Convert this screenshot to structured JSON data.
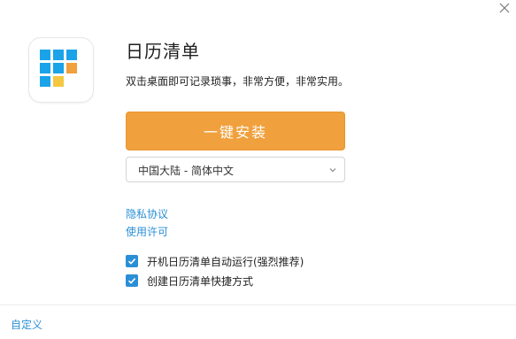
{
  "window": {
    "close_icon": "close-icon"
  },
  "app": {
    "icon": "calendar-grid-icon",
    "name": "日历清单",
    "description": "双击桌面即可记录琐事，非常方便，非常实用。"
  },
  "install": {
    "button_label": "一键安装",
    "accent_color": "#f0a03c"
  },
  "region_select": {
    "selected": "中国大陆 - 简体中文",
    "chevron_icon": "chevron-down-icon"
  },
  "links": {
    "privacy": "隐私协议",
    "license": "使用许可"
  },
  "options": [
    {
      "label": "开机日历清单自动运行(强烈推荐)",
      "checked": true
    },
    {
      "label": "创建日历清单快捷方式",
      "checked": true
    }
  ],
  "footer": {
    "customize": "自定义"
  },
  "colors": {
    "link": "#2a8fd6",
    "checkbox": "#2a8fd6",
    "tile_blue": "#1aa3e8",
    "tile_orange": "#f0a03c",
    "tile_yellow": "#f5c842"
  }
}
